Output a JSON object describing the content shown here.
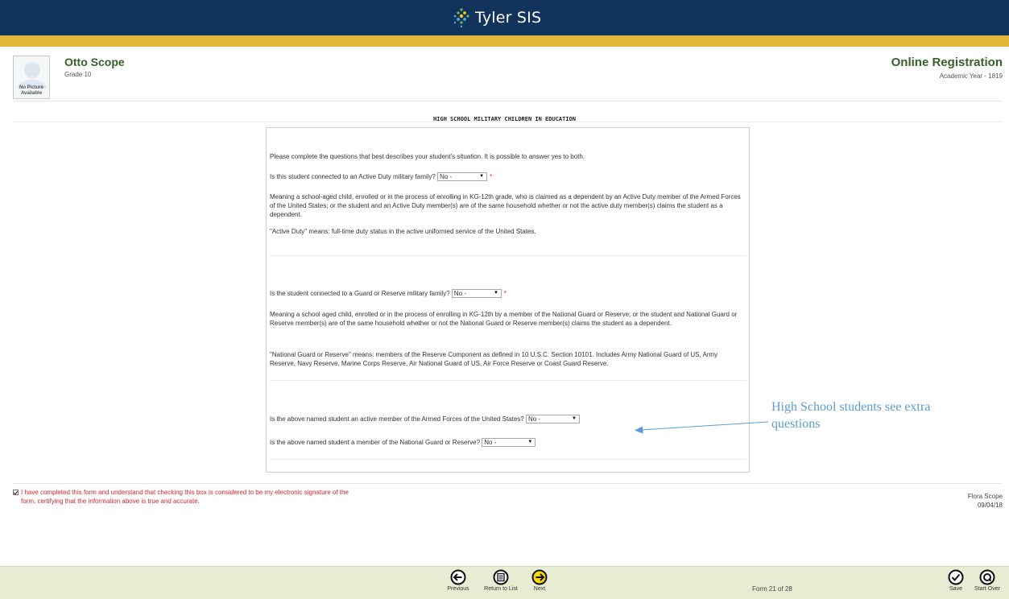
{
  "header": {
    "app_name": "Tyler SIS"
  },
  "student": {
    "name": "Otto Scope",
    "grade": "Grade 10",
    "photo_text_1": "No Picture",
    "photo_text_2": "Available"
  },
  "registration": {
    "title": "Online Registration",
    "academic_year": "Academic Year - 1819"
  },
  "form": {
    "title": "HIGH SCHOOL MILITARY CHILDREN IN EDUCATION",
    "intro": "Please complete the questions that best describes your student's situation. It is possible to answer yes to both.",
    "q1": {
      "label": "Is this student connected to an Active Duty military family?",
      "value": "No -",
      "required_mark": "*",
      "description": "Meaning a school-aged child, enrolled or in the process of enrolling in KG-12th grade, who is claimed as a dependent by an Active Duty member of the Armed Forces of the United States; or the student and an Active Duty member(s) are of the same household whether or not the active duty member(s) claims the student as a dependent.",
      "definition": "\"Active Duty\" means: full-time duty status in the active uniformed service of the United States."
    },
    "q2": {
      "label": "Is the student connected to a Guard or Reserve military family?",
      "value": "No -",
      "required_mark": "*",
      "description": "Meaning a school aged child, enrolled or in the process of enrolling in KG-12th by a member of the National Guard or Reserve; or the student and National Guard or Reserve member(s) are of the same household whether or not the National Guard or Reserve member(s) claims the student as a dependent.",
      "definition": "\"National Guard or Reserve\" means: members of the Reserve Component as defined in 10 U.S.C. Section 10101. Includes Army National Guard of US, Army Reserve, Navy Reserve, Marine Corps Reserve, Air National Guard of US, Air Force Reserve or Coast Guard Reserve."
    },
    "q3": {
      "label": "Is the above named student an active member of the Armed Forces of the United States?",
      "value": "No -"
    },
    "q4": {
      "label": "Is the above named student a member of the National Guard or Reserve?",
      "value": "No -"
    }
  },
  "annotation": {
    "text": "High School students see extra questions",
    "color": "#5b9bd5"
  },
  "signature": {
    "checked": true,
    "text": "I have completed this form and understand that checking this box is considered to be my electronic signature of the form, certifying that the information above is true and accurate.",
    "signer_name": "Flora Scope",
    "signed_date": "09/04/18"
  },
  "footer": {
    "previous_label": "Previous",
    "return_label": "Return to List",
    "next_label": "Next",
    "form_count": "Form 21 of 28",
    "save_label": "Save",
    "start_over_label": "Start Over"
  },
  "colors": {
    "topbar": "#12345c",
    "gold": "#e0b73a",
    "brand_green": "#36612a",
    "required_red": "#d9262b",
    "footer_bg": "#e8ecd3",
    "next_yellow": "#f5d90a"
  }
}
